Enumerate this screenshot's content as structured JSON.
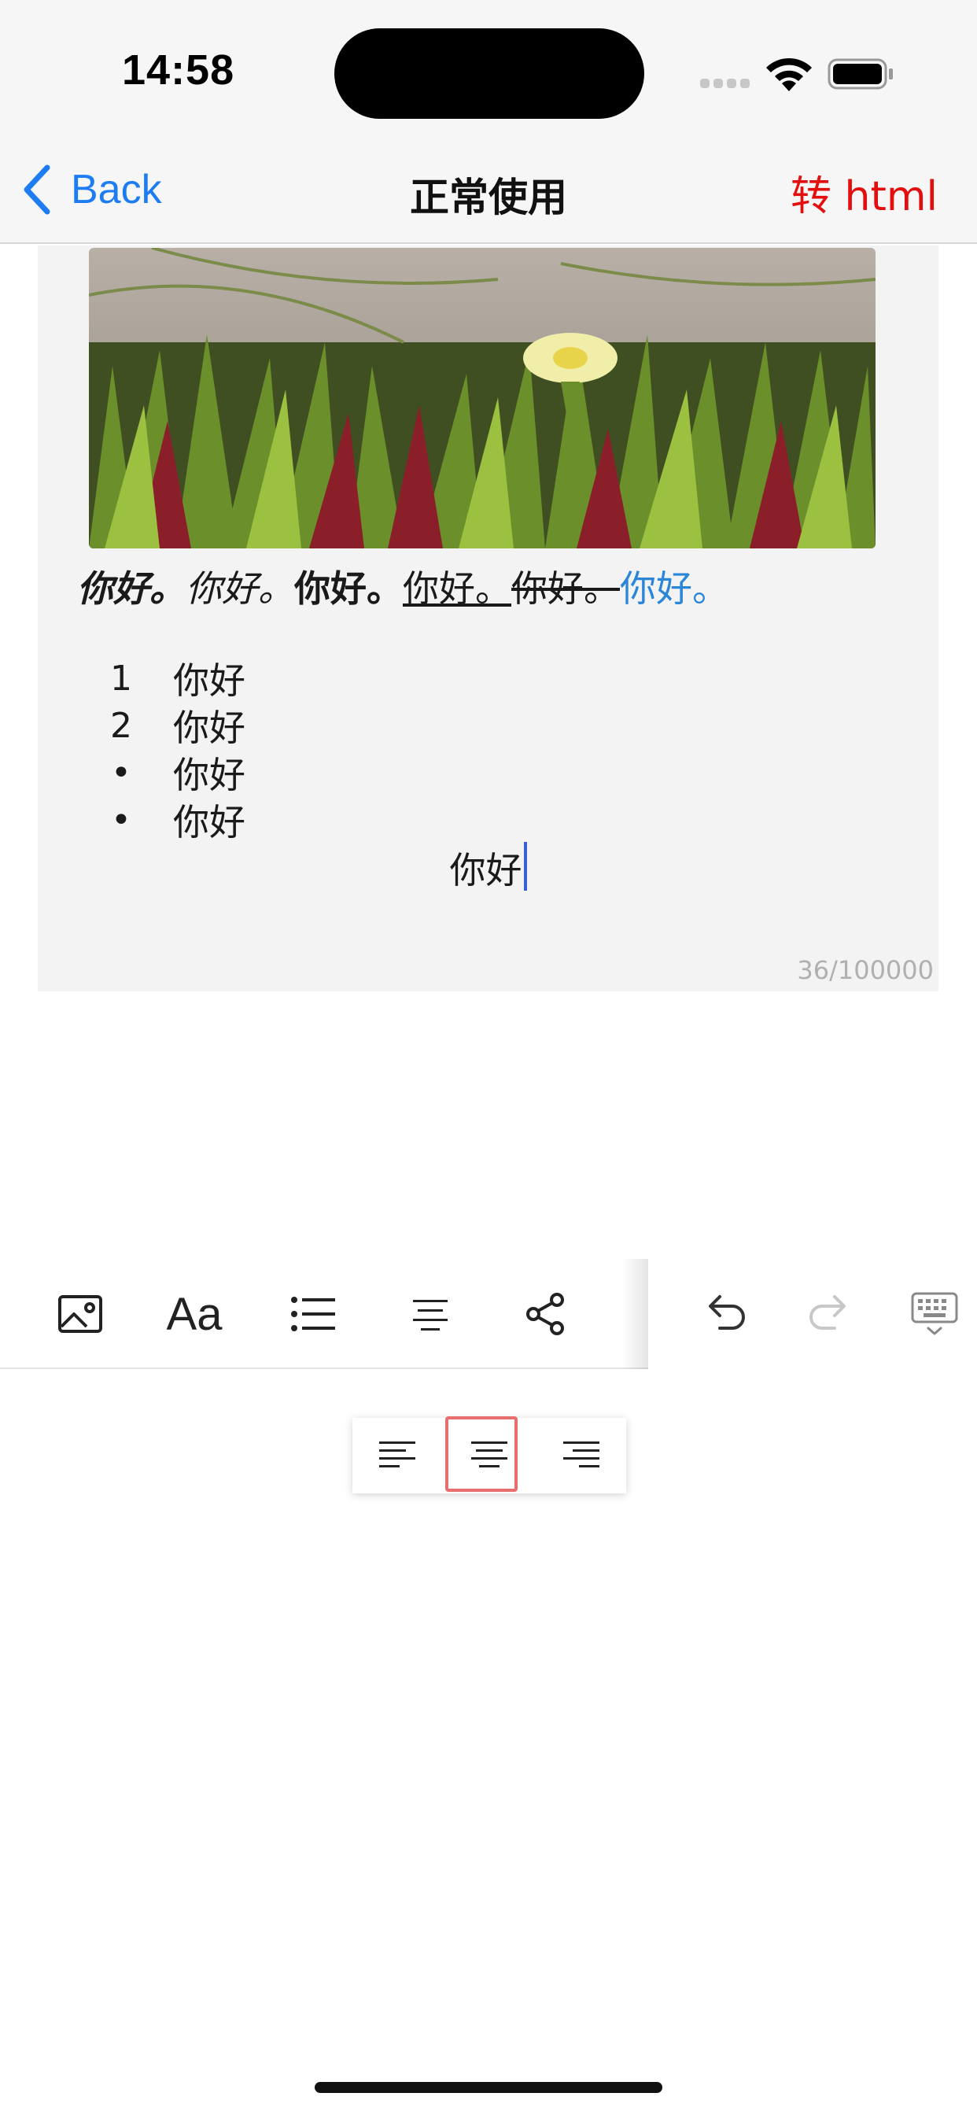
{
  "status_bar": {
    "time": "14:58",
    "icons": [
      "signal-icon",
      "wifi-icon",
      "battery-icon"
    ]
  },
  "nav": {
    "back_label": "Back",
    "title": "正常使用",
    "action_label": "转 html"
  },
  "colors": {
    "accent_blue": "#1d7cf2",
    "action_red": "#e30e0e",
    "link_blue": "#2a86d8",
    "editor_bg": "#f3f3f3",
    "selected_outline": "#e96f6f"
  },
  "editor": {
    "image": "flower-photo",
    "styled_line": [
      {
        "text": "你好。",
        "style": "bold-italic"
      },
      {
        "text": "你好。",
        "style": "italic"
      },
      {
        "text": "你好。",
        "style": "bold"
      },
      {
        "text": "你好。",
        "style": "underline"
      },
      {
        "text": "你好。",
        "style": "strikethrough"
      },
      {
        "text": "你好。",
        "style": "link"
      }
    ],
    "list": [
      {
        "marker": "1",
        "text": "你好"
      },
      {
        "marker": "2",
        "text": "你好"
      },
      {
        "marker": "•",
        "text": "你好"
      },
      {
        "marker": "•",
        "text": "你好"
      }
    ],
    "centered_text": "你好",
    "counter": "36/100000"
  },
  "toolbar": {
    "items": [
      "image-icon",
      "font-icon",
      "list-icon",
      "align-center-icon",
      "share-icon",
      "undo-icon",
      "redo-icon",
      "keyboard-dismiss-icon"
    ],
    "font_label": "Aa"
  },
  "align_popup": {
    "options": [
      "align-left",
      "align-center",
      "align-right"
    ],
    "selected": "align-center"
  }
}
